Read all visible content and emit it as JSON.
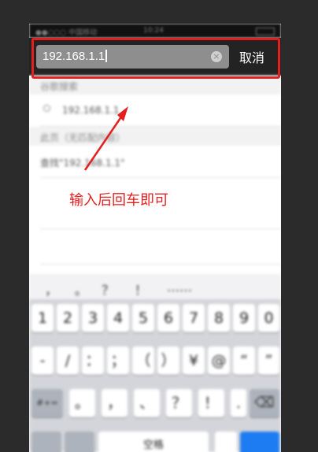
{
  "statusbar": {
    "carrier": "●●○○○ 中国移动 ",
    "time": "10:24"
  },
  "navbar": {
    "url_value": "192.168.1.1",
    "clear_glyph": "×",
    "cancel_label": "取消"
  },
  "suggestions": {
    "section_google": "谷歌搜索",
    "google_query": "192.168.1.1",
    "section_page": "此页（无匹配内容）",
    "find_on_page": "查找\"192.168.1.1\""
  },
  "annotation": {
    "text": "输入后回车即可",
    "color": "#e41f1f"
  },
  "keyboard": {
    "suggestion_bar": [
      "，",
      "。",
      "？",
      "！",
      "……"
    ],
    "row1": [
      "1",
      "2",
      "3",
      "4",
      "5",
      "6",
      "7",
      "8",
      "9",
      "0"
    ],
    "row2": [
      "-",
      "/",
      "：",
      "；",
      "（",
      "）",
      "¥",
      "@",
      "“",
      "”"
    ],
    "row3_mode": "#+=",
    "row3": [
      "。",
      "，",
      "、",
      "？",
      "！",
      "."
    ],
    "row3_delete": "⌫",
    "bottom_space": "空格"
  }
}
